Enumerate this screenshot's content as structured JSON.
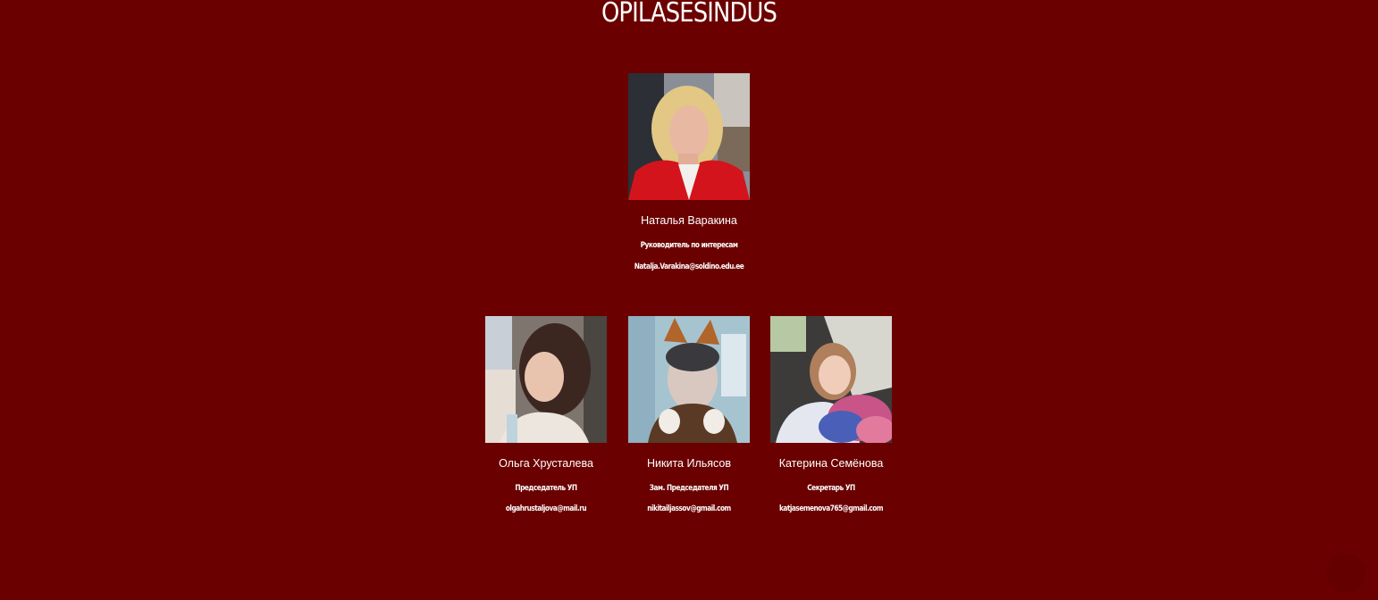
{
  "page": {
    "title": "OPILASESINDUS"
  },
  "colors": {
    "background": "#6b0000",
    "text": "#ffffff"
  },
  "leader": {
    "name": "Наталья Варакина",
    "role": "Руководитель по интересам",
    "email": "Natalja.Varakina@soldino.edu.ee",
    "photo": "portrait-blonde-woman-red-jacket"
  },
  "members": [
    {
      "name": "Ольга Хрусталева",
      "role": "Председатель УП",
      "email": "olgahrustaljova@mail.ru",
      "photo": "portrait-girl-dark-hair-mask"
    },
    {
      "name": "Никита Ильясов",
      "role": "Зам. Председателя УП",
      "email": "nikitailjassov@gmail.com",
      "photo": "portrait-boy-fox-ears-filter"
    },
    {
      "name": "Катерина Семёнова",
      "role": "Секретарь УП",
      "email": "katjasemenova765@gmail.com",
      "photo": "portrait-girl-in-car-flowers"
    }
  ],
  "scroll_top": {
    "icon": "scroll-top-icon"
  }
}
